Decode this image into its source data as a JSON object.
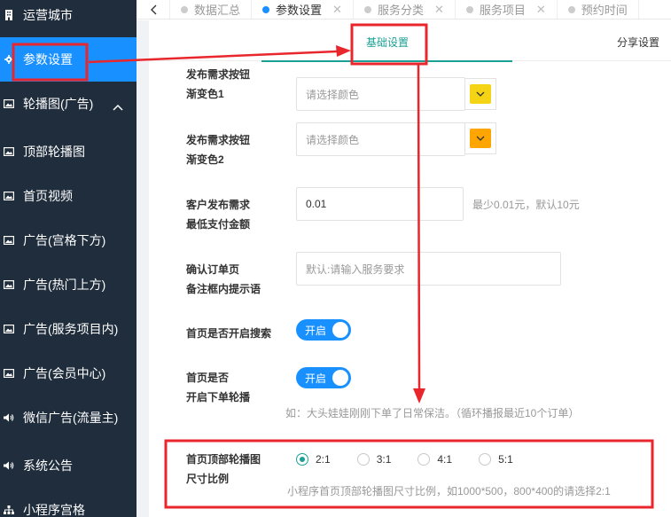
{
  "sidebar": {
    "items": [
      {
        "label": "运营城市",
        "icon": "building-icon"
      },
      {
        "label": "参数设置",
        "icon": "gear-icon"
      },
      {
        "label": "轮播图(广告)",
        "icon": "image-icon"
      },
      {
        "label": "顶部轮播图",
        "icon": "image-icon"
      },
      {
        "label": "首页视频",
        "icon": "image-icon"
      },
      {
        "label": "广告(宫格下方)",
        "icon": "image-icon"
      },
      {
        "label": "广告(热门上方)",
        "icon": "image-icon"
      },
      {
        "label": "广告(服务项目内)",
        "icon": "image-icon"
      },
      {
        "label": "广告(会员中心)",
        "icon": "image-icon"
      },
      {
        "label": "微信广告(流量主)",
        "icon": "speaker-icon"
      },
      {
        "label": "系统公告",
        "icon": "speaker-icon"
      },
      {
        "label": "小程序宫格",
        "icon": "sitemap-icon"
      }
    ]
  },
  "tabs": [
    {
      "label": "数据汇总",
      "active": false,
      "closable": false
    },
    {
      "label": "参数设置",
      "active": true,
      "closable": true
    },
    {
      "label": "服务分类",
      "active": false,
      "closable": true
    },
    {
      "label": "服务项目",
      "active": false,
      "closable": true
    },
    {
      "label": "预约时间",
      "active": false,
      "closable": false
    }
  ],
  "subtabs": {
    "basic": "基础设置",
    "share": "分享设置"
  },
  "form": {
    "gradient1": {
      "label_line1": "发布需求按钮",
      "label_line2": "渐变色1",
      "placeholder": "请选择颜色",
      "swatch_color": "#f5d315"
    },
    "gradient2": {
      "label_line1": "发布需求按钮",
      "label_line2": "渐变色2",
      "placeholder": "请选择颜色",
      "swatch_color": "#ffa500"
    },
    "min_pay": {
      "label_line1": "客户发布需求",
      "label_line2": "最低支付金额",
      "value": "0.01",
      "hint": "最少0.01元，默认10元"
    },
    "order_hint": {
      "label_line1": "确认订单页",
      "label_line2": "备注框内提示语",
      "placeholder": "默认:请输入服务要求"
    },
    "home_search": {
      "label": "首页是否开启搜索",
      "switch_text": "开启"
    },
    "order_carousel": {
      "label_line1": "首页是否",
      "label_line2": "开启下单轮播",
      "switch_text": "开启",
      "hint": "如：大头娃娃刚刚下单了日常保洁。（循环播报最近10个订单）"
    },
    "banner_ratio": {
      "label_line1": "首页顶部轮播图",
      "label_line2": "尺寸比例",
      "options": [
        "2:1",
        "3:1",
        "4:1",
        "5:1"
      ],
      "selected": "2:1",
      "hint": "小程序首页顶部轮播图尺寸比例，如1000*500，800*400的请选择2:1"
    }
  },
  "colors": {
    "sidebar_bg": "#1f2d3d",
    "sidebar_active": "#1890ff",
    "accent": "#1aa094",
    "switch_on": "#1890ff",
    "annotation_red": "#e8262b"
  }
}
